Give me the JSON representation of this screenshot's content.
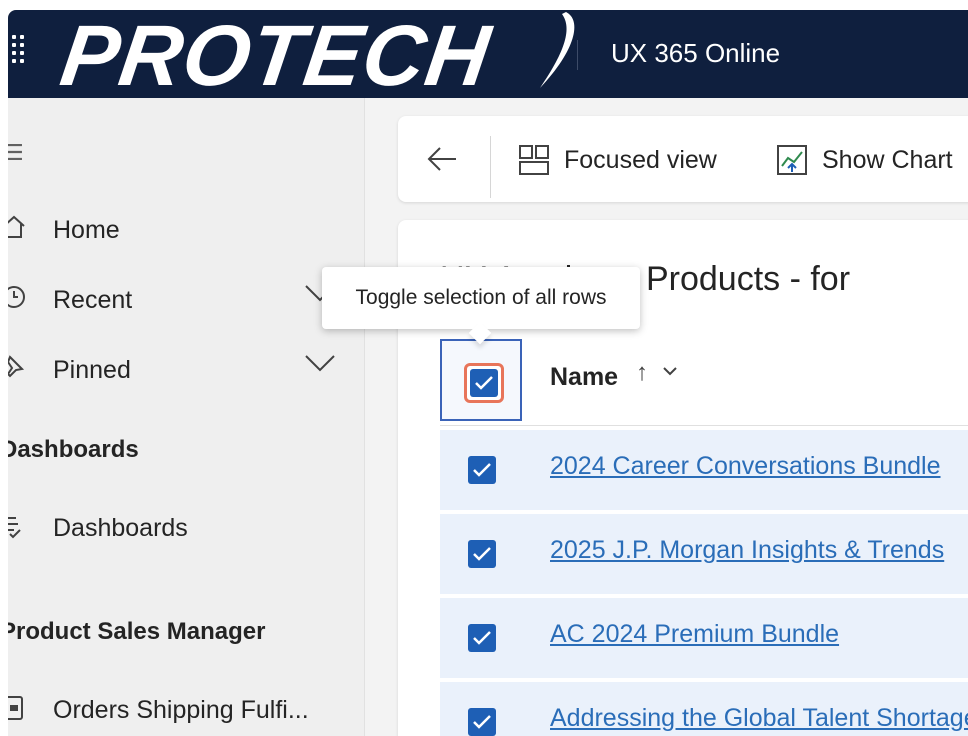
{
  "header": {
    "logo_text": "PROTECH",
    "app_title": "UX 365 Online"
  },
  "sidebar": {
    "menu_icon": "hamburger-icon",
    "items": [
      {
        "label": "Home",
        "icon": "home-icon"
      },
      {
        "label": "Recent",
        "icon": "clock-icon",
        "expandable": true
      },
      {
        "label": "Pinned",
        "icon": "pin-icon",
        "expandable": true
      }
    ],
    "sections": [
      {
        "heading": "Dashboards",
        "items": [
          {
            "label": "Dashboards",
            "icon": "dashboard-icon"
          }
        ]
      },
      {
        "heading": "Product Sales Manager",
        "items": [
          {
            "label": "Orders Shipping Fulfi...",
            "icon": "orders-icon"
          }
        ]
      }
    ]
  },
  "commandbar": {
    "back_icon": "back-arrow-icon",
    "focused_view_label": "Focused view",
    "show_chart_label": "Show Chart"
  },
  "grid": {
    "view_title": "UX Academy Products - for",
    "columns": [
      {
        "label": "Name",
        "sort": "ascending"
      }
    ],
    "select_all_checked": true,
    "rows": [
      {
        "name": "2024 Career Conversations Bundle",
        "selected": true
      },
      {
        "name": "2025 J.P. Morgan Insights & Trends",
        "selected": true
      },
      {
        "name": "AC 2024 Premium Bundle",
        "selected": true
      },
      {
        "name": "Addressing the Global Talent Shortage",
        "selected": true
      }
    ]
  },
  "tooltip": {
    "text": "Toggle selection of all rows"
  },
  "colors": {
    "topbar": "#0f1f3e",
    "checkbox": "#1e5fb5",
    "link": "#2a6db8",
    "row_selected_bg": "#eaf1fb",
    "highlight": "#e8755a"
  }
}
